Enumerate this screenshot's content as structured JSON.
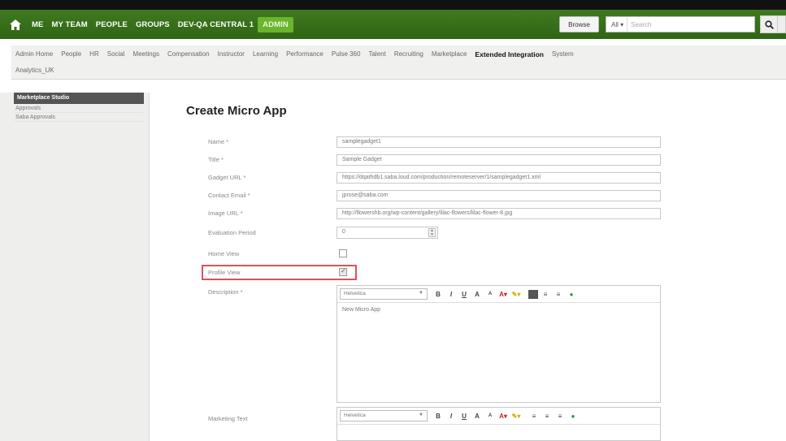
{
  "topnav": {
    "items": [
      "ME",
      "MY TEAM",
      "PEOPLE",
      "GROUPS",
      "DEV-QA CENTRAL 1",
      "ADMIN"
    ],
    "browse_label": "Browse",
    "search_scope": "All",
    "search_placeholder": "Search",
    "accent": "#6ab52c",
    "bar_color": "#2f6514"
  },
  "subnav": {
    "row1": [
      "Admin Home",
      "People",
      "HR",
      "Social",
      "Meetings",
      "Compensation",
      "Instructor",
      "Learning",
      "Performance",
      "Pulse 360",
      "Talent",
      "Recruiting",
      "Marketplace",
      "Extended Integration",
      "System"
    ],
    "row2": [
      "Analytics_UK"
    ],
    "active": "Extended Integration"
  },
  "sidebar": {
    "heading": "Marketplace Studio",
    "items": [
      "Approvals",
      "Saba Approvals"
    ]
  },
  "form": {
    "title": "Create Micro App",
    "name_label": "Name *",
    "name_value": "samplegadget1",
    "title_label": "Title *",
    "title_value": "Sample Gadget",
    "gadget_url_label": "Gadget URL *",
    "gadget_url_value": "https://dqathdb1.saba.loud.com/production/remoteserver/1/samplegadget1.xml",
    "contact_email_label": "Contact Email *",
    "contact_email_value": "jprose@saba.com",
    "image_url_label": "Image URL *",
    "image_url_value": "http://flowershb.org/wp-content/gallery/lilac-flowers/lilac-flower-8.jpg",
    "eval_period_label": "Evaluation Period",
    "eval_period_value": "0",
    "home_view_label": "Home View",
    "profile_view_label": "Profile View",
    "description_label": "Description *",
    "description_font": "Helvetica",
    "description_text": "New Micro App",
    "marketing_label": "Marketing Text",
    "marketing_font": "Helvetica"
  }
}
